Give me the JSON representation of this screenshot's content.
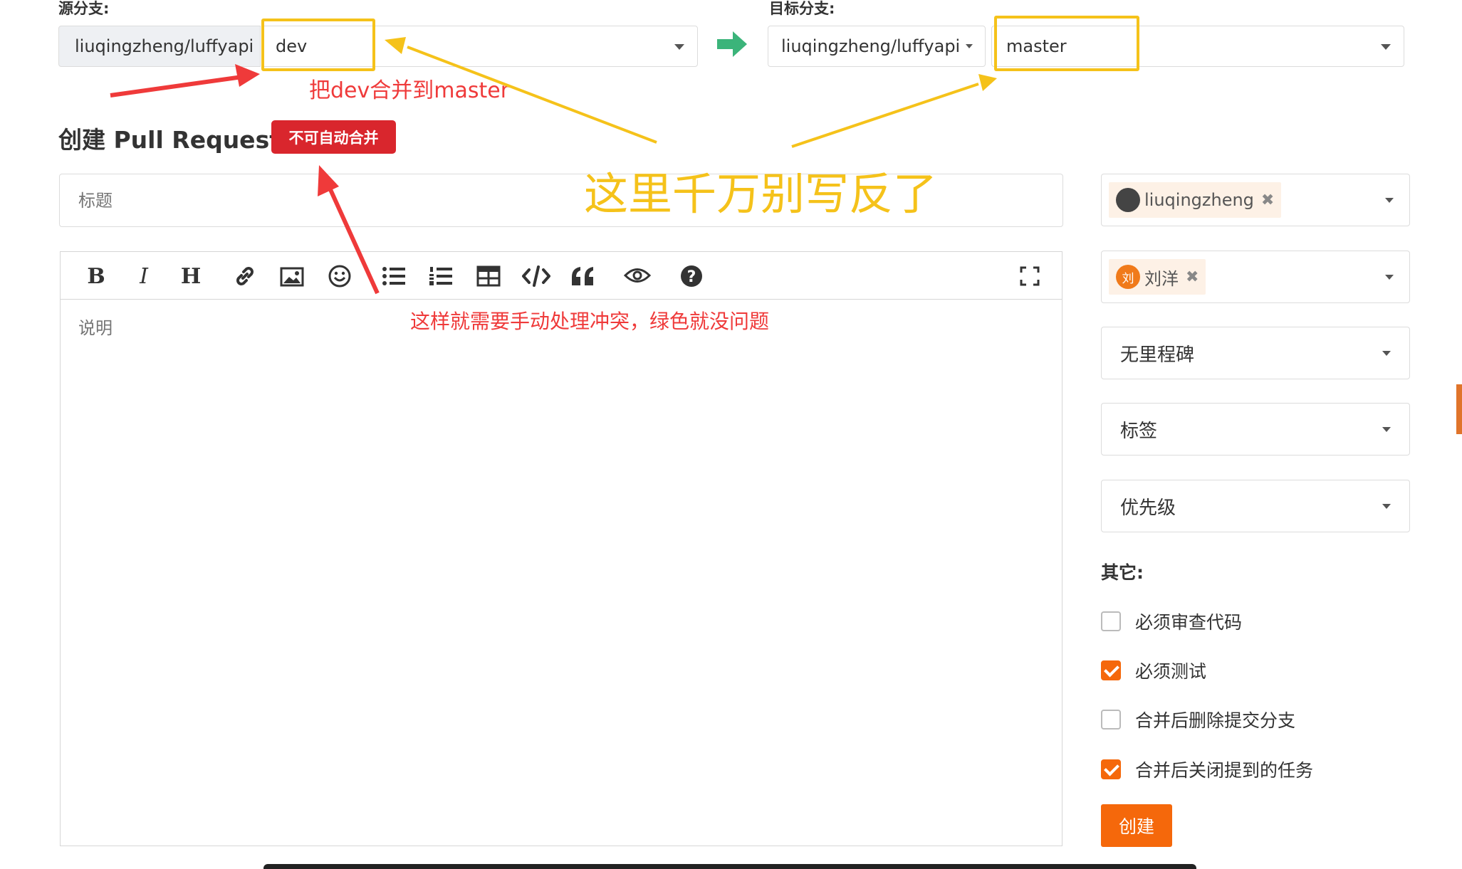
{
  "source": {
    "label": "源分支:",
    "repo": "liuqingzheng/luffyapi",
    "branch": "dev"
  },
  "target": {
    "label": "目标分支:",
    "repo": "liuqingzheng/luffyapi",
    "branch": "master"
  },
  "page_title": "创建 Pull Request",
  "merge_badge": "不可自动合并",
  "title_placeholder": "标题",
  "description_placeholder": "说明",
  "annotations": {
    "merge_note": "把dev合并到master",
    "warning": "这里千万别写反了",
    "conflict_note": "这样就需要手动处理冲突，绿色就没问题"
  },
  "toolbar": {
    "bold": "B",
    "italic": "I",
    "heading": "H"
  },
  "sidebar": {
    "reviewer": "liuqingzheng",
    "tester": "刘洋",
    "tester_avatar": "刘",
    "milestone": "无里程碑",
    "labels": "标签",
    "priority": "优先级",
    "other_label": "其它:",
    "options": [
      {
        "label": "必须审查代码",
        "checked": false
      },
      {
        "label": "必须测试",
        "checked": true
      },
      {
        "label": "合并后删除提交分支",
        "checked": false
      },
      {
        "label": "合并后关闭提到的任务",
        "checked": true
      }
    ],
    "create_button": "创建"
  },
  "colors": {
    "accent": "#f5680b",
    "danger": "#d9262d",
    "highlight": "#f5c21a",
    "arrow_green": "#3bb47a",
    "annotation_red": "#ef3a3a"
  }
}
